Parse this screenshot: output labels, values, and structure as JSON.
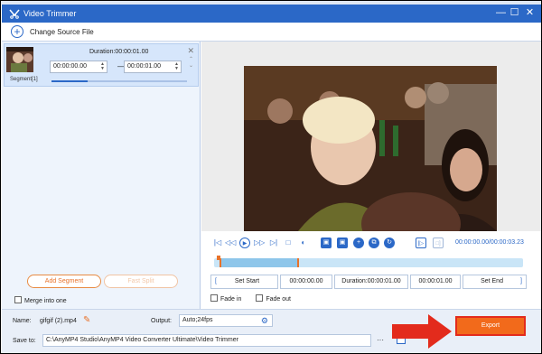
{
  "window": {
    "title": "Video Trimmer",
    "controls": [
      "minimize",
      "restore",
      "close"
    ]
  },
  "toolbar": {
    "change_source": "Change Source File"
  },
  "segment": {
    "label": "Segment[1]",
    "duration": "Duration:00:00:01.00",
    "start": "00:00:00.00",
    "end": "00:00:01.00",
    "dash": "—"
  },
  "left_actions": {
    "add_segment": "Add Segment",
    "fast_split": "Fast Split",
    "merge": "Merge into one"
  },
  "player": {
    "timecode": "00:00:00.00/00:00:03.23",
    "progress": 0.0
  },
  "trim": {
    "set_start": "Set Start",
    "start_time": "00:00:00.00",
    "duration": "Duration:00:00:01.00",
    "end_time": "00:00:01.00",
    "set_end": "Set End",
    "fade_in": "Fade in",
    "fade_out": "Fade out"
  },
  "output": {
    "name_label": "Name:",
    "name_value": "gifgif (2).mp4",
    "output_label": "Output:",
    "output_value": "Auto;24fps",
    "save_label": "Save to:",
    "save_path": "C:\\AnyMP4 Studio\\AnyMP4 Video Converter Ultimate\\Video Trimmer",
    "more": "···",
    "export": "Export"
  },
  "colors": {
    "accent": "#2b68c7",
    "export": "#f26a1b",
    "arrow": "#e32b1c"
  }
}
